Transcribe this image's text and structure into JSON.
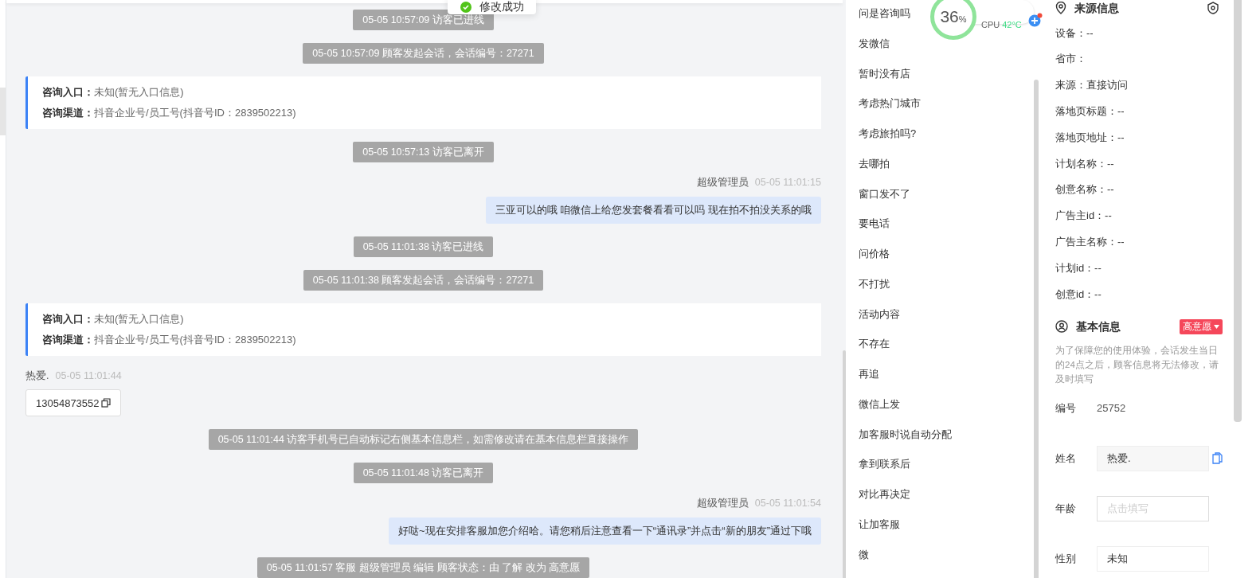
{
  "toast": {
    "text": "修改成功"
  },
  "chat": {
    "items": [
      {
        "kind": "system",
        "text": "05-05 10:57:09 访客已进线"
      },
      {
        "kind": "system",
        "text": "05-05 10:57:09 顾客发起会话，会话编号：27271"
      },
      {
        "kind": "info",
        "entry_label": "咨询入口：",
        "entry_value": "未知(暂无入口信息)",
        "channel_label": "咨询渠道：",
        "channel_value": "抖音企业号/员工号(抖音号ID：2839502213)"
      },
      {
        "kind": "system",
        "text": "05-05 10:57:13 访客已离开"
      },
      {
        "kind": "agent",
        "sender": "超级管理员",
        "time": "05-05 11:01:15",
        "text": "三亚可以的哦 咱微信上给您发套餐看看可以吗 现在拍不拍没关系的哦"
      },
      {
        "kind": "system",
        "text": "05-05 11:01:38 访客已进线"
      },
      {
        "kind": "system",
        "text": "05-05 11:01:38 顾客发起会话，会话编号：27271"
      },
      {
        "kind": "info",
        "entry_label": "咨询入口：",
        "entry_value": "未知(暂无入口信息)",
        "channel_label": "咨询渠道：",
        "channel_value": "抖音企业号/员工号(抖音号ID：2839502213)"
      },
      {
        "kind": "visitor",
        "sender": "热爱.",
        "time": "05-05 11:01:44",
        "phone": "13054873552"
      },
      {
        "kind": "system",
        "text": "05-05 11:01:44 访客手机号已自动标记右侧基本信息栏，如需修改请在基本信息栏直接操作"
      },
      {
        "kind": "system",
        "text": "05-05 11:01:48 访客已离开"
      },
      {
        "kind": "agent",
        "sender": "超级管理员",
        "time": "05-05 11:01:54",
        "text": "好哒~现在安排客服加您介绍哈。请您稍后注意查看一下“通讯录”并点击“新的朋友”通过下哦"
      },
      {
        "kind": "system",
        "text": "05-05 11:01:57 客服 超级管理员 编辑 顾客状态：由 了解 改为 高意愿"
      }
    ]
  },
  "quick_replies": [
    "问是咨询吗",
    "发微信",
    "暂时没有店",
    "考虑热门城市",
    "考虑旅拍吗?",
    "去哪拍",
    "窗口发不了",
    "要电话",
    "问价格",
    "不打扰",
    "活动内容",
    "不存在",
    "再追",
    "微信上发",
    "加客服时说自动分配",
    "拿到联系后",
    "对比再决定",
    "让加客服",
    "微"
  ],
  "monitor": {
    "usage": "36",
    "unit": "%",
    "cpu_label": "CPU",
    "cpu_temp": "42°C"
  },
  "source_info": {
    "title": "来源信息",
    "rows": [
      "设备：--",
      "省市：",
      "来源：直接访问",
      "落地页标题：--",
      "落地页地址：--",
      "计划名称：--",
      "创意名称：--",
      "广告主id：--",
      "广告主名称：--",
      "计划id：--",
      "创意id：--"
    ]
  },
  "basic_info": {
    "title": "基本信息",
    "intent": "高意愿",
    "note": "为了保障您的使用体验，会话发生当日的24点之后，顾客信息将无法修改，请及时填写",
    "fields": [
      {
        "kind": "plain",
        "label": "编号",
        "value": "25752"
      },
      {
        "kind": "filled",
        "label": "姓名",
        "value": "热爱."
      },
      {
        "kind": "input",
        "label": "年龄",
        "placeholder": "点击填写"
      },
      {
        "kind": "select",
        "label": "性别",
        "value": "未知"
      }
    ]
  }
}
